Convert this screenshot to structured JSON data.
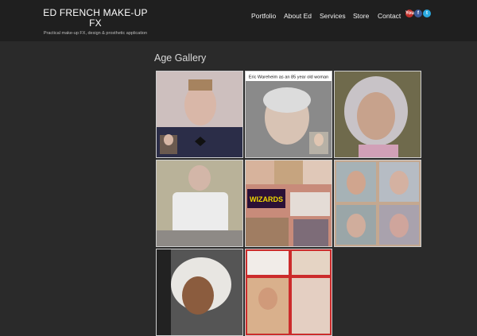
{
  "site": {
    "title": "ED FRENCH MAKE-UP FX",
    "tagline": "Practical make-up FX, design & prosthetic application"
  },
  "nav": {
    "items": [
      "Portfolio",
      "About Ed",
      "Services",
      "Store",
      "Contact"
    ]
  },
  "social": {
    "icons": [
      {
        "name": "youtube-icon",
        "glyph": "You",
        "color": "#c4302b"
      },
      {
        "name": "facebook-icon",
        "glyph": "f",
        "color": "#3b5998"
      },
      {
        "name": "twitter-icon",
        "glyph": "t",
        "color": "#2aa9e0"
      }
    ]
  },
  "page": {
    "title": "Age Gallery"
  },
  "gallery": {
    "thumbs": [
      {
        "name": "gallery-thumb-1",
        "caption": ""
      },
      {
        "name": "gallery-thumb-2",
        "caption": "Eric Wareheim as an 85 year old woman"
      },
      {
        "name": "gallery-thumb-3",
        "caption": ""
      },
      {
        "name": "gallery-thumb-4",
        "caption": ""
      },
      {
        "name": "gallery-thumb-5",
        "caption": "WIZARDS"
      },
      {
        "name": "gallery-thumb-6",
        "caption": ""
      },
      {
        "name": "gallery-thumb-7",
        "caption": ""
      },
      {
        "name": "gallery-thumb-8",
        "caption": ""
      }
    ]
  },
  "colors": {
    "background": "#2a2a2a",
    "header": "#1f1f1f",
    "thumb_border": "#cfcfcf"
  }
}
